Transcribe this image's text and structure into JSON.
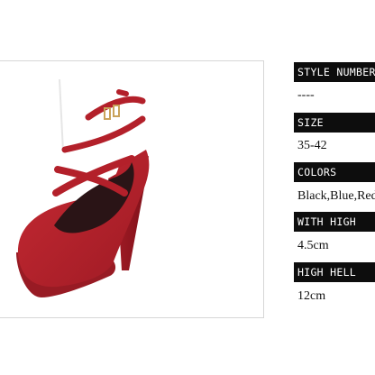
{
  "product": {
    "image_alt": "red suede platform high heel pump with crossed ankle straps"
  },
  "specs": [
    {
      "label": "STYLE NUMBER",
      "value": "----"
    },
    {
      "label": "SIZE",
      "value": "35-42"
    },
    {
      "label": "COLORS",
      "value": "Black,Blue,Red"
    },
    {
      "label": "WITH HIGH",
      "value": "4.5cm"
    },
    {
      "label": "HIGH HELL",
      "value": "12cm"
    }
  ],
  "colors": {
    "suede_red": "#b3202a",
    "header_bg": "#0d0d0d",
    "header_text": "#ffffff",
    "value_text": "#111111"
  }
}
